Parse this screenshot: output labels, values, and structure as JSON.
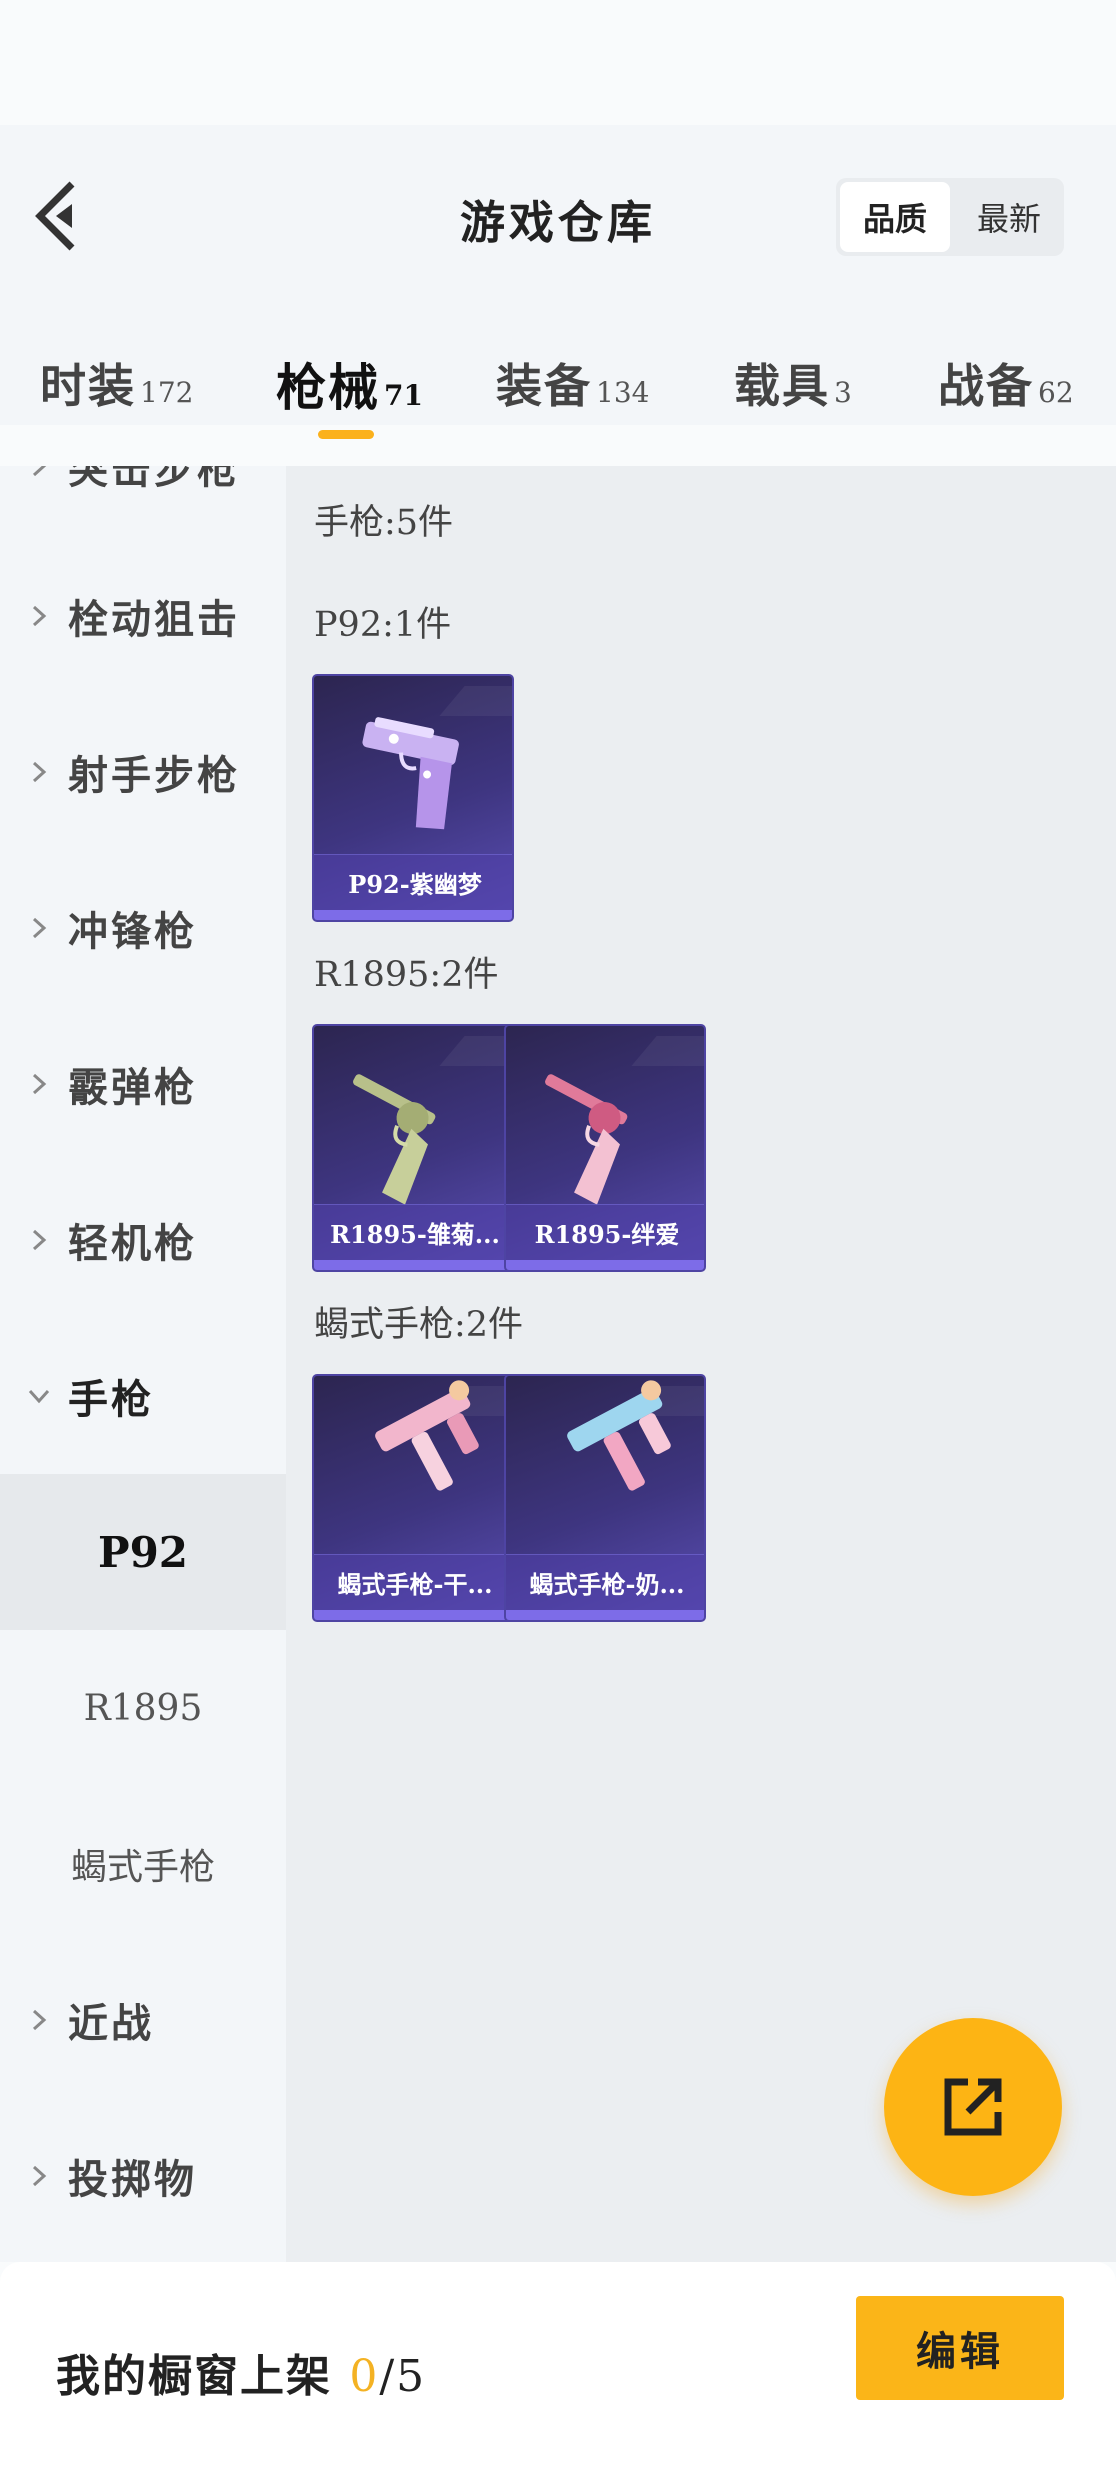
{
  "header": {
    "title": "游戏仓库",
    "sort_options": [
      "品质",
      "最新"
    ],
    "sort_active": "品质"
  },
  "tabs": [
    {
      "label": "时装",
      "count": "172"
    },
    {
      "label": "枪械",
      "count": "71"
    },
    {
      "label": "装备",
      "count": "134"
    },
    {
      "label": "载具",
      "count": "3"
    },
    {
      "label": "战备",
      "count": "62"
    }
  ],
  "sidebar": {
    "partial_item": "突击步枪",
    "items": [
      "栓动狙击",
      "射手步枪",
      "冲锋枪",
      "霰弹枪",
      "轻机枪",
      "手枪"
    ],
    "sub_items": [
      "P92",
      "R1895",
      "蝎式手枪"
    ],
    "active_sub": "P92",
    "after_items": [
      "近战",
      "投掷物"
    ]
  },
  "content": {
    "category_summary": "手枪:5件",
    "groups": [
      {
        "header": "P92:1件",
        "items": [
          "P92-紫幽梦"
        ]
      },
      {
        "header": "R1895:2件",
        "items": [
          "R1895-雏菊...",
          "R1895-绊爱"
        ]
      },
      {
        "header": "蝎式手枪:2件",
        "items": [
          "蝎式手枪-干...",
          "蝎式手枪-奶..."
        ]
      }
    ]
  },
  "footer": {
    "label": "我的橱窗上架",
    "current": "0",
    "total": "/5",
    "edit_label": "编辑"
  },
  "colors": {
    "accent": "#fbb518",
    "card_bg": "#3e3580",
    "card_bar": "#7d6ce8"
  }
}
